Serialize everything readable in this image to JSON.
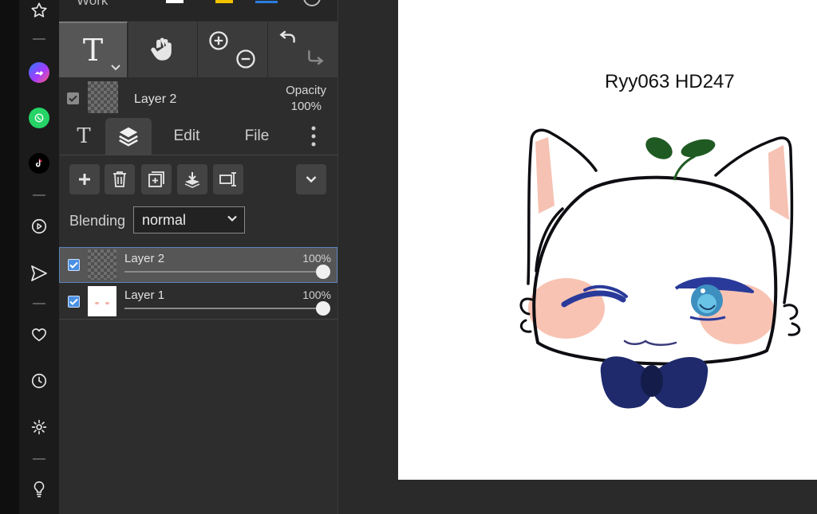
{
  "sidebar": {
    "icons": [
      "star-icon",
      "messenger-icon",
      "whatsapp-icon",
      "tiktok-icon",
      "play-icon",
      "send-icon",
      "heart-icon",
      "clock-icon",
      "gear-icon",
      "lightbulb-icon"
    ]
  },
  "top_strip": {
    "label": "Work"
  },
  "toolbar": {
    "text_tool_glyph": "T",
    "tools": [
      "text-tool",
      "hand-tool",
      "zoom-tool",
      "undo-redo"
    ]
  },
  "layer_info": {
    "name": "Layer 2",
    "opacity_label": "Opacity",
    "opacity_value": "100%"
  },
  "tabs": {
    "text_glyph": "T",
    "edit": "Edit",
    "file": "File"
  },
  "blending": {
    "label": "Blending",
    "value": "normal"
  },
  "layers": [
    {
      "name": "Layer 2",
      "opacity": "100%",
      "opacity_fraction": 1.0,
      "checked": true,
      "selected": true
    },
    {
      "name": "Layer 1",
      "opacity": "100%",
      "opacity_fraction": 1.0,
      "checked": true,
      "selected": false
    }
  ],
  "canvas": {
    "caption": "Ryy063 HD247"
  },
  "colors": {
    "accent_blue": "#4a90e2",
    "panel_bg": "#2d2d2d",
    "sidebar_bg": "#1b1b1b"
  }
}
